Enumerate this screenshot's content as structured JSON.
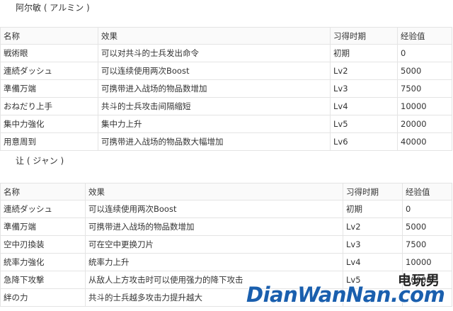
{
  "section1": {
    "title": "阿尔敏 ( アルミン )",
    "headers": [
      "名称",
      "效果",
      "习得时期",
      "经验值"
    ],
    "rows": [
      [
        "戦術眼",
        "可以对共斗的士兵发出命令",
        "初期",
        "0"
      ],
      [
        "連続ダッシュ",
        "可以连续使用两次Boost",
        "Lv2",
        "5000"
      ],
      [
        "準備万端",
        "可携带进入战场的物品数增加",
        "Lv3",
        "7500"
      ],
      [
        "おねだり上手",
        "共斗的士兵攻击间隔缩短",
        "Lv4",
        "10000"
      ],
      [
        "集中力強化",
        "集中力上升",
        "Lv5",
        "20000"
      ],
      [
        "用意周到",
        "可携带进入战场的物品数大幅增加",
        "Lv6",
        "40000"
      ]
    ]
  },
  "section2": {
    "title": "让 ( ジャン )",
    "headers": [
      "名称",
      "效果",
      "习得时期",
      "经验值"
    ],
    "rows": [
      [
        "連続ダッシュ",
        "可以连续使用两次Boost",
        "初期",
        "0"
      ],
      [
        "準備万端",
        "可携带进入战场的物品数增加",
        "Lv2",
        "5000"
      ],
      [
        "空中刃換装",
        "可在空中更换刀片",
        "Lv3",
        "7500"
      ],
      [
        "統率力強化",
        "统率力上升",
        "Lv4",
        "10000"
      ],
      [
        "急降下攻撃",
        "从敌人上方攻击时可以使用强力的降下攻击",
        "Lv5",
        "20000"
      ],
      [
        "絆の力",
        "共斗的士兵越多攻击力提升越大",
        "",
        ""
      ]
    ]
  },
  "watermark": {
    "cn": "电玩男",
    "en": "DianWanNan.com"
  }
}
